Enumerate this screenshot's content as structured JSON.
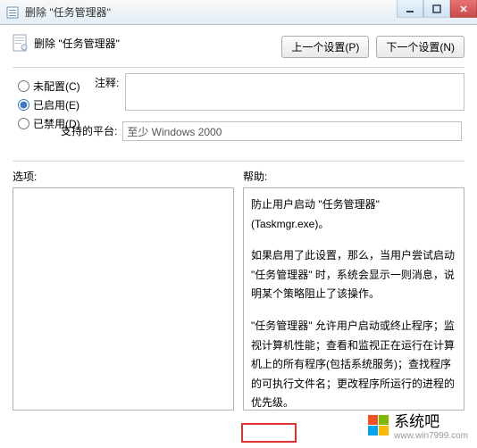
{
  "window": {
    "title": "删除 \"任务管理器\"",
    "min_tooltip": "Minimize",
    "max_tooltip": "Maximize",
    "close_tooltip": "Close"
  },
  "header": {
    "caption": "删除 \"任务管理器\"",
    "prev_btn": "上一个设置(P)",
    "next_btn": "下一个设置(N)"
  },
  "radios": {
    "not_configured": "未配置(C)",
    "enabled": "已启用(E)",
    "disabled": "已禁用(D)",
    "selected": "enabled"
  },
  "fields": {
    "comment_label": "注释:",
    "comment_value": "",
    "platform_label": "支持的平台:",
    "platform_value": "至少 Windows 2000"
  },
  "sections": {
    "options_label": "选项:",
    "help_label": "帮助:"
  },
  "help": {
    "p1": "防止用户启动 \"任务管理器\" (Taskmgr.exe)。",
    "p2": "如果启用了此设置，那么，当用户尝试启动 \"任务管理器\" 时，系统会显示一则消息，说明某个策略阻止了该操作。",
    "p3": "\"任务管理器\" 允许用户启动或终止程序；监视计算机性能；查看和监视正在运行在计算机上的所有程序(包括系统服务)；查找程序的可执行文件名；更改程序所运行的进程的优先级。"
  },
  "watermark": {
    "text": "系统吧",
    "url": "www.win7999.com"
  },
  "colors": {
    "logo": [
      "#f25022",
      "#7fba00",
      "#00a4ef",
      "#ffb900"
    ]
  }
}
